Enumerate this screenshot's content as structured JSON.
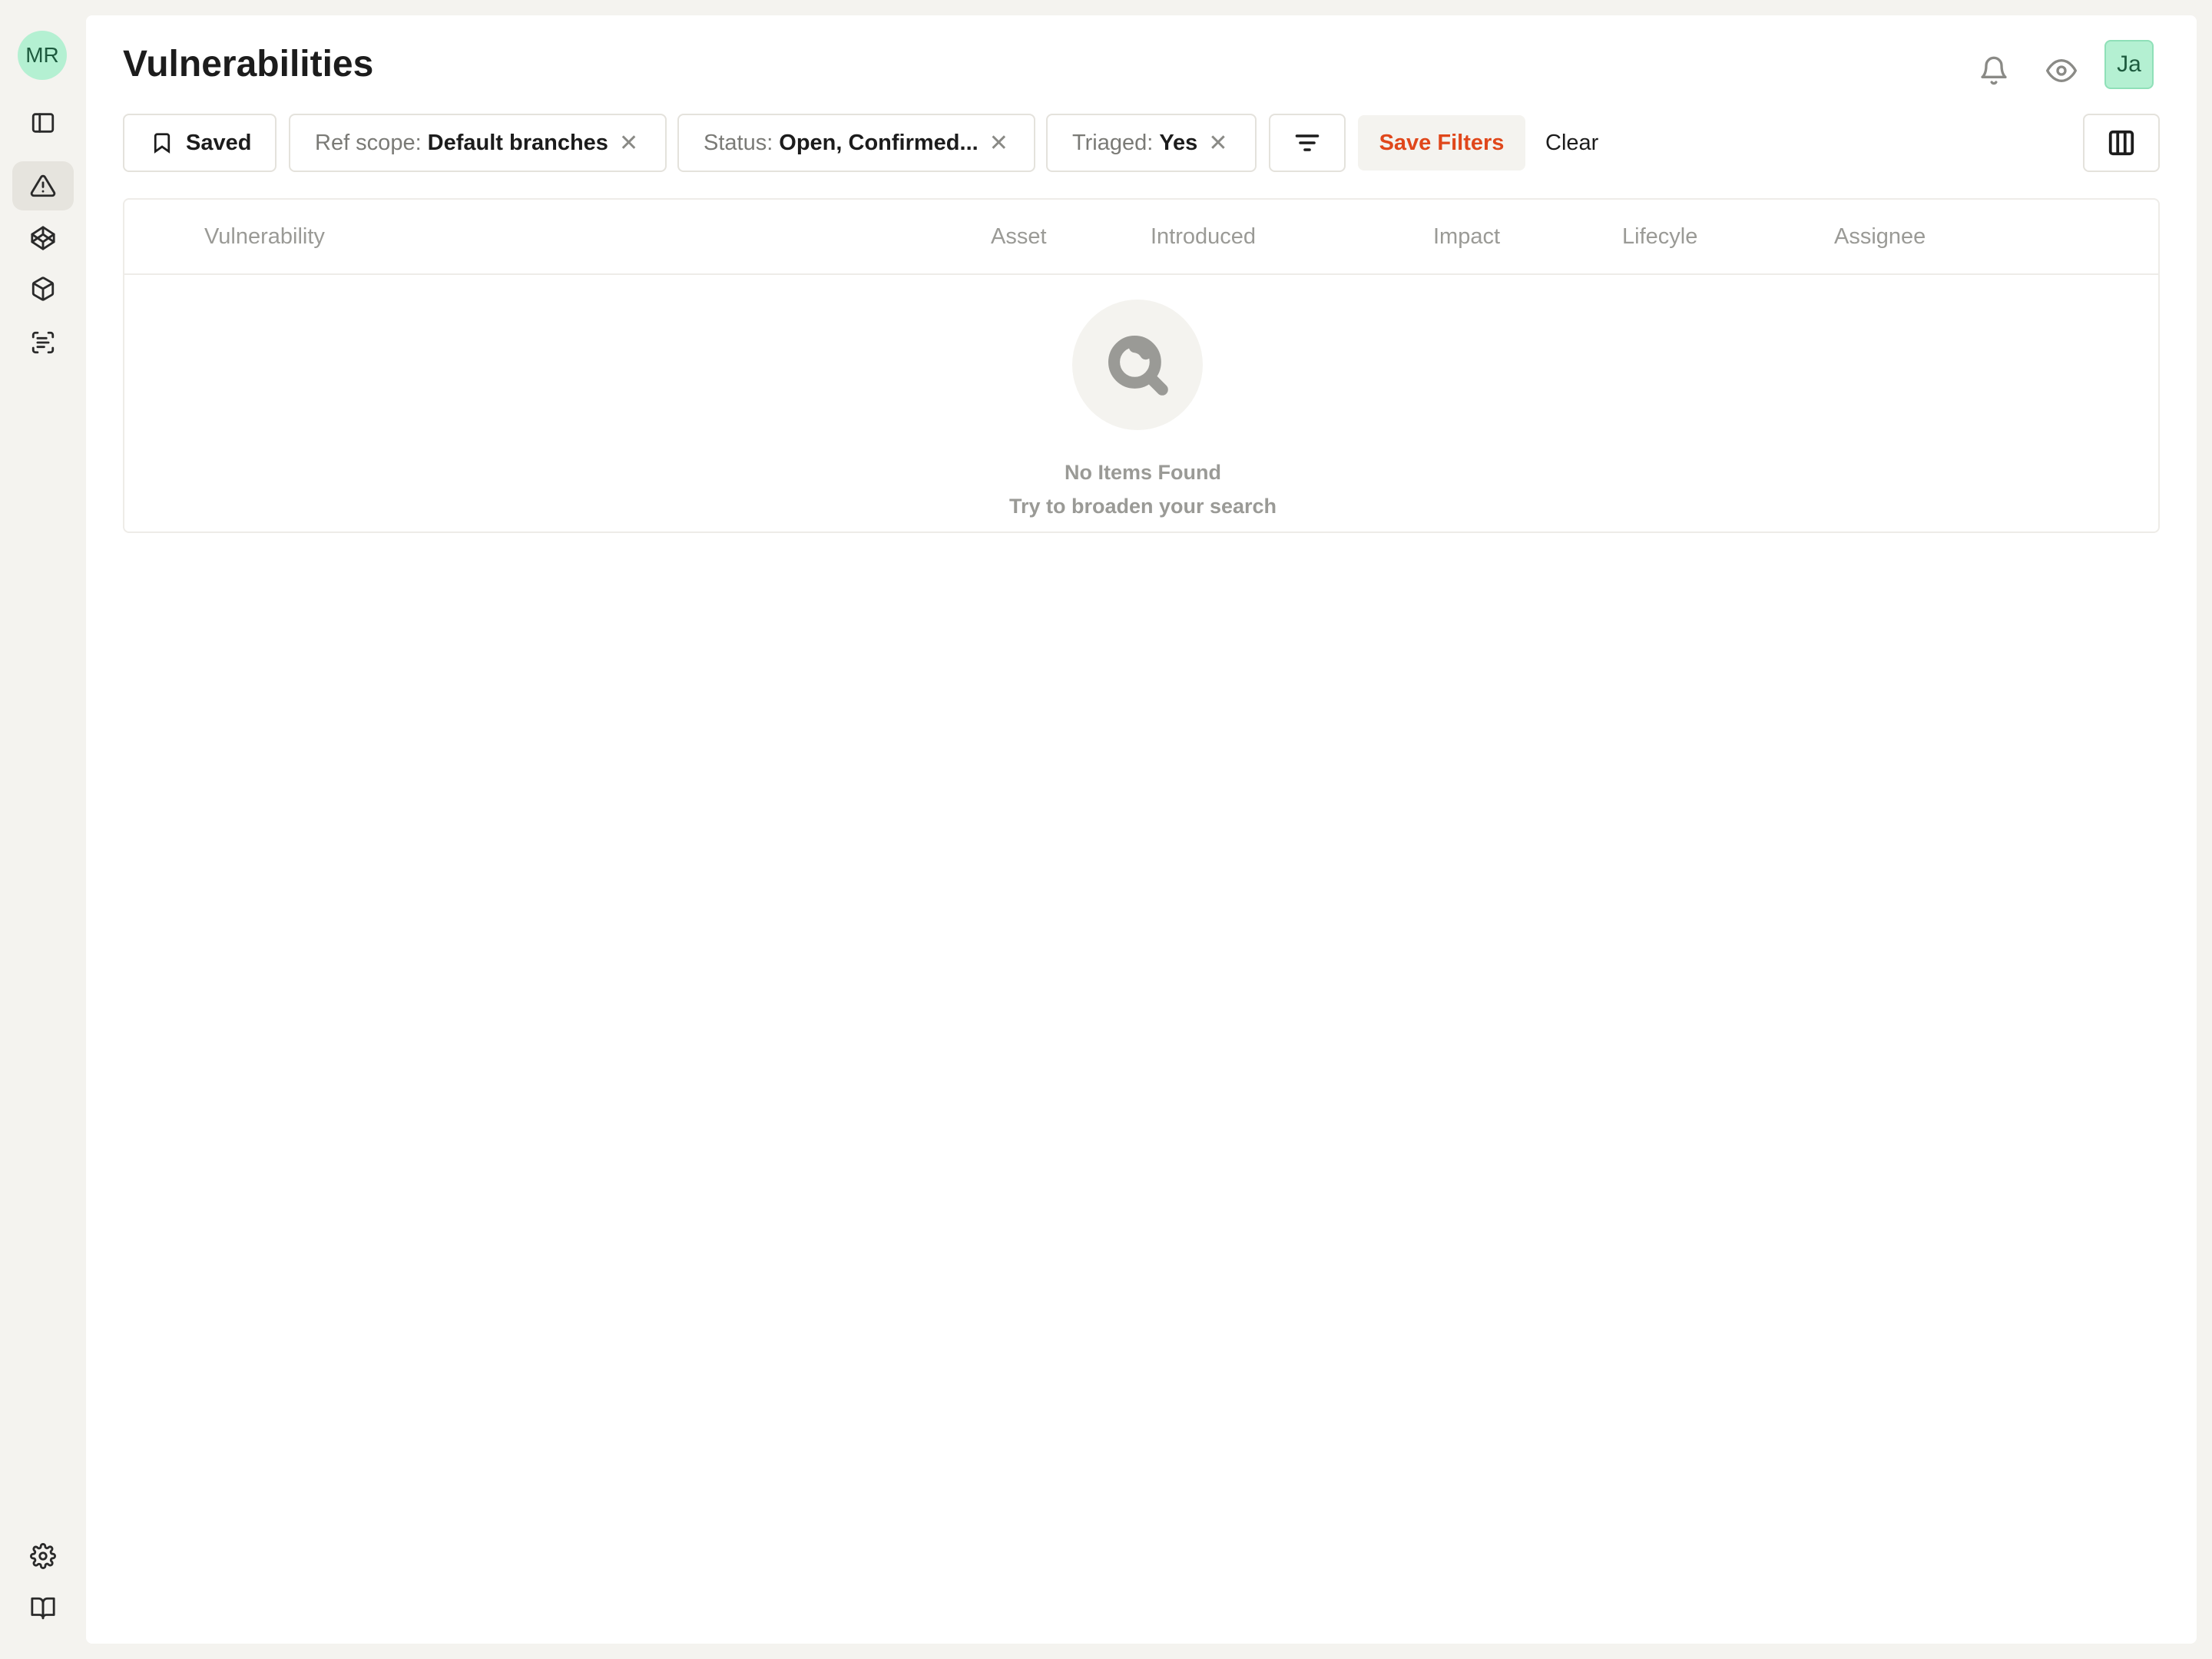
{
  "sidebar": {
    "org_initials": "MR",
    "items": [
      {
        "id": "toggle",
        "icon": "sidebar-toggle-icon"
      },
      {
        "id": "vulnerabilities",
        "icon": "alert-triangle-icon",
        "active": true
      },
      {
        "id": "code",
        "icon": "codepen-icon"
      },
      {
        "id": "packages",
        "icon": "box-icon"
      },
      {
        "id": "scan",
        "icon": "scan-text-icon"
      }
    ],
    "bottom_items": [
      {
        "id": "settings",
        "icon": "gear-icon"
      },
      {
        "id": "docs",
        "icon": "book-open-icon"
      }
    ]
  },
  "header": {
    "title": "Vulnerabilities",
    "user_initials": "Ja"
  },
  "filters": {
    "saved_label": "Saved",
    "chips": [
      {
        "label": "Ref scope:",
        "value": "Default branches"
      },
      {
        "label": "Status:",
        "value": "Open, Confirmed..."
      },
      {
        "label": "Triaged:",
        "value": "Yes"
      }
    ],
    "save_filters_label": "Save Filters",
    "clear_label": "Clear"
  },
  "table": {
    "columns": [
      "Vulnerability",
      "Asset",
      "Introduced",
      "Impact",
      "Lifecyle",
      "Assignee"
    ],
    "empty_title": "No Items Found",
    "empty_subtitle": "Try to broaden your search"
  },
  "colors": {
    "accent": "#e0471b",
    "avatar_bg": "#b4f0d2",
    "background": "#f4f3ef"
  }
}
